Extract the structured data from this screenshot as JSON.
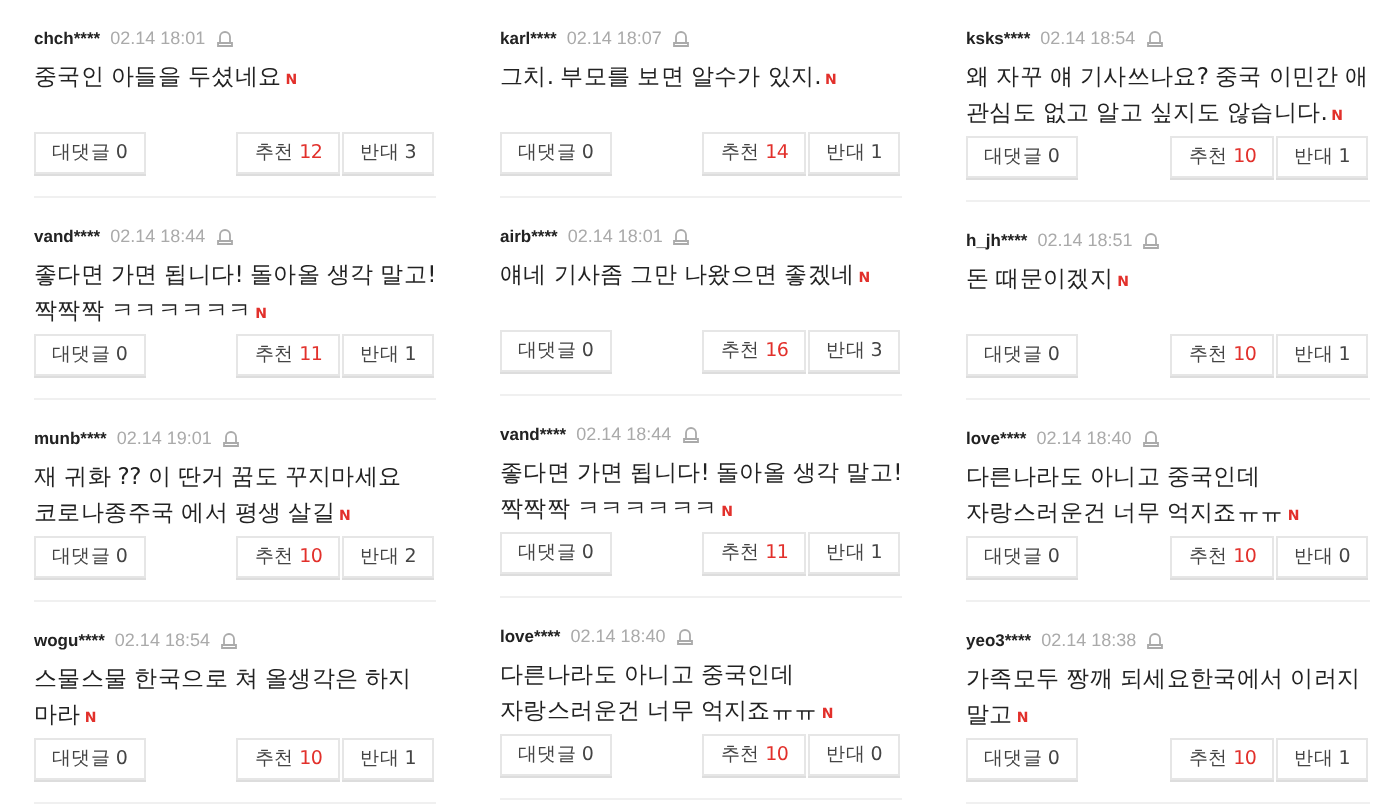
{
  "columns": [
    {
      "comments": [
        {
          "user": "chch****",
          "date": "02.14 18:01",
          "text": "중국인 아들을 두셨네요",
          "new_mark": "N",
          "reply_button": "대댓글 0",
          "like": {
            "label": "추천",
            "count": "12"
          },
          "dislike": "반대 3"
        },
        {
          "user": "vand****",
          "date": "02.14 18:44",
          "text": "좋다면 가면 됩니다! 돌아올 생각 말고!짝짝짝 ㅋㅋㅋㅋㅋㅋ",
          "new_mark": "N",
          "reply_button": "대댓글 0",
          "like": {
            "label": "추천",
            "count": "11"
          },
          "dislike": "반대 1"
        },
        {
          "user": "munb****",
          "date": "02.14 19:01",
          "text": "재 귀화 ?? 이 딴거 꿈도 꾸지마세요 코로나종주국 에서 평생 살길",
          "new_mark": "N",
          "reply_button": "대댓글 0",
          "like": {
            "label": "추천",
            "count": "10"
          },
          "dislike": "반대 2"
        },
        {
          "user": "wogu****",
          "date": "02.14 18:54",
          "text": "스물스물 한국으로 쳐 올생각은 하지 마라",
          "new_mark": "N",
          "reply_button": "대댓글 0",
          "like": {
            "label": "추천",
            "count": "10"
          },
          "dislike": "반대 1"
        }
      ]
    },
    {
      "comments": [
        {
          "user": "karl****",
          "date": "02.14 18:07",
          "text": "그치. 부모를 보면 알수가 있지.",
          "new_mark": "N",
          "reply_button": "대댓글 0",
          "like": {
            "label": "추천",
            "count": "14"
          },
          "dislike": "반대 1"
        },
        {
          "user": "airb****",
          "date": "02.14 18:01",
          "text": "얘네 기사좀 그만 나왔으면 좋겠네",
          "new_mark": "N",
          "reply_button": "대댓글 0",
          "like": {
            "label": "추천",
            "count": "16"
          },
          "dislike": "반대 3"
        },
        {
          "user": "vand****",
          "date": "02.14 18:44",
          "text": "좋다면 가면 됩니다! 돌아올 생각 말고!짝짝짝 ㅋㅋㅋㅋㅋㅋ",
          "new_mark": "N",
          "reply_button": "대댓글 0",
          "like": {
            "label": "추천",
            "count": "11"
          },
          "dislike": "반대 1"
        },
        {
          "user": "love****",
          "date": "02.14 18:40",
          "text": "다른나라도 아니고 중국인데 자랑스러운건 너무 억지죠ㅠㅠ",
          "new_mark": "N",
          "reply_button": "대댓글 0",
          "like": {
            "label": "추천",
            "count": "10"
          },
          "dislike": "반대 0"
        }
      ]
    },
    {
      "comments": [
        {
          "user": "ksks****",
          "date": "02.14 18:54",
          "text": "왜 자꾸 얘 기사쓰나요? 중국 이민간 애 관심도 없고 알고 싶지도 않습니다.",
          "new_mark": "N",
          "reply_button": "대댓글 0",
          "like": {
            "label": "추천",
            "count": "10"
          },
          "dislike": "반대 1"
        },
        {
          "user": "h_jh****",
          "date": "02.14 18:51",
          "text": "돈 때문이겠지",
          "new_mark": "N",
          "reply_button": "대댓글 0",
          "like": {
            "label": "추천",
            "count": "10"
          },
          "dislike": "반대 1"
        },
        {
          "user": "love****",
          "date": "02.14 18:40",
          "text": "다른나라도 아니고 중국인데 자랑스러운건 너무 억지죠ㅠㅠ",
          "new_mark": "N",
          "reply_button": "대댓글 0",
          "like": {
            "label": "추천",
            "count": "10"
          },
          "dislike": "반대 0"
        },
        {
          "user": "yeo3****",
          "date": "02.14 18:38",
          "text": "가족모두 짱깨 되세요한국에서 이러지 말고",
          "new_mark": "N",
          "reply_button": "대댓글 0",
          "like": {
            "label": "추천",
            "count": "10"
          },
          "dislike": "반대 1"
        }
      ]
    }
  ]
}
